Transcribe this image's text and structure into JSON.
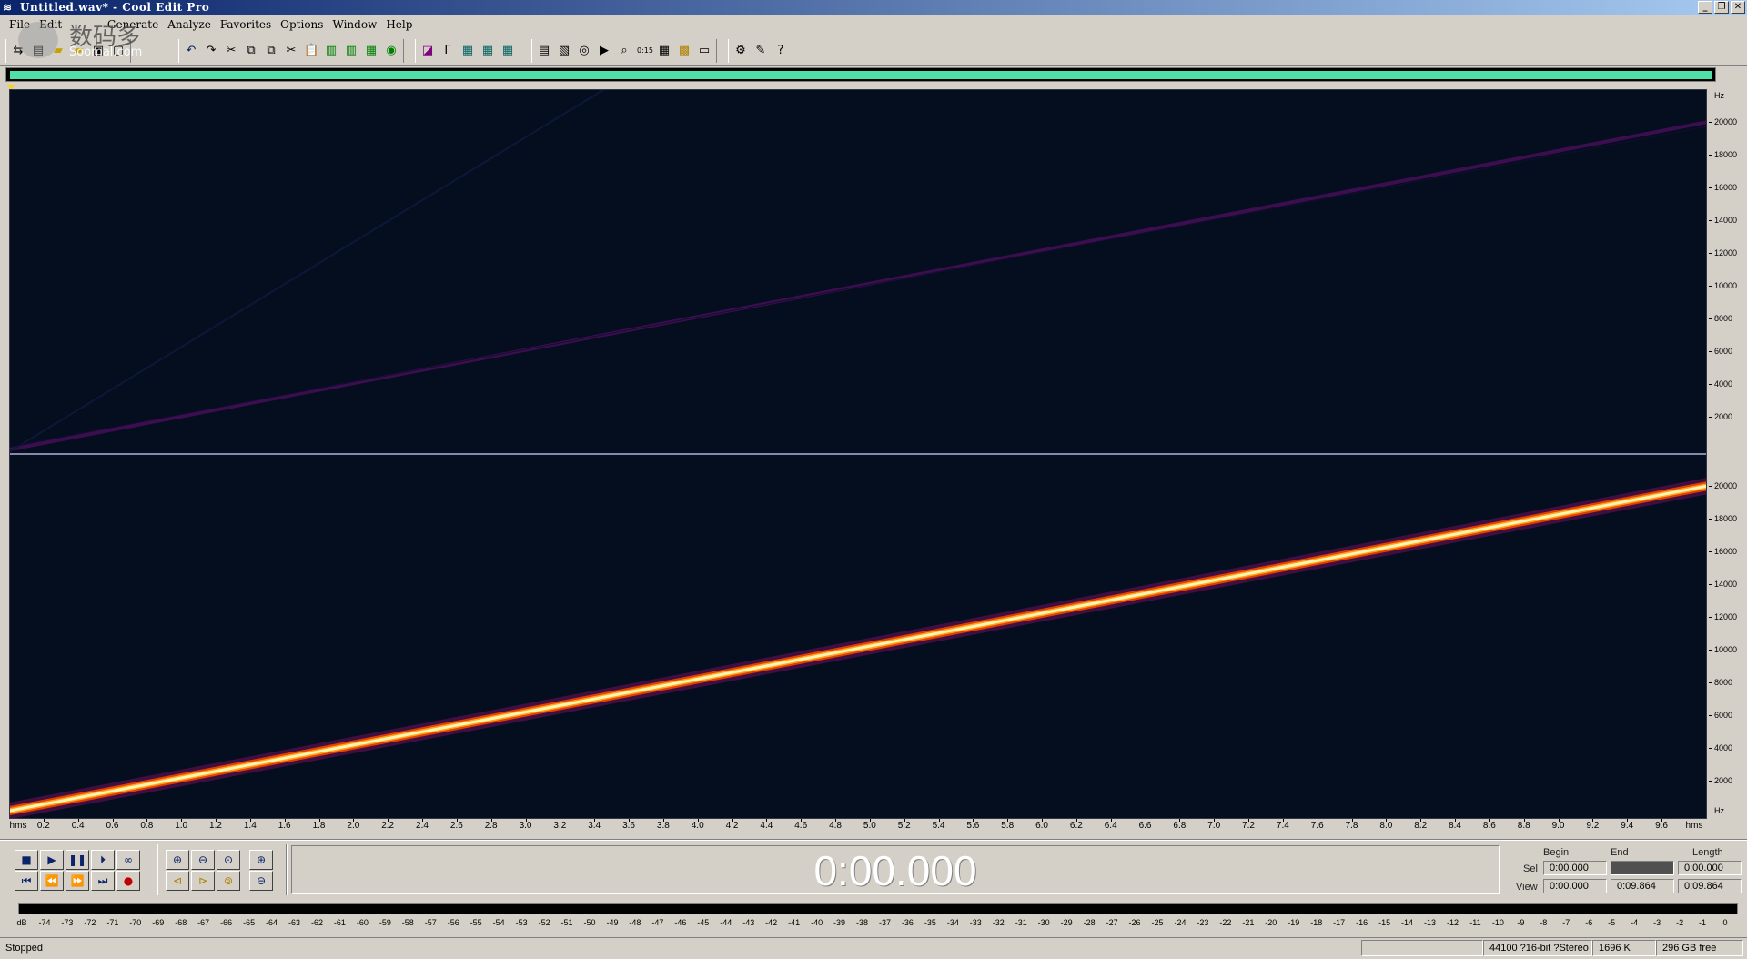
{
  "window": {
    "title": "Untitled.wav* - Cool Edit Pro",
    "app_icon": "waveform-icon",
    "buttons": [
      "_",
      "❐",
      "✕"
    ]
  },
  "menu": [
    "File",
    "Edit",
    "View",
    "Generate",
    "Analyze",
    "Favorites",
    "Options",
    "Window",
    "Help"
  ],
  "watermark": {
    "cn": "数码多",
    "en": "Soomal.com"
  },
  "spectrogram": {
    "channels": 2,
    "upper_channel_sweep_color": "#4a1060",
    "lower_channel_sweep_color": "#fff2a0",
    "background": "#050e1e"
  },
  "hz_ruler": {
    "unit": "Hz",
    "labels": [
      "20000",
      "18000",
      "16000",
      "14000",
      "12000",
      "10000",
      "8000",
      "6000",
      "4000",
      "2000"
    ]
  },
  "time_ruler": {
    "start_label": "hms",
    "end_label": "hms",
    "labels": [
      "0.2",
      "0.4",
      "0.6",
      "0.8",
      "1.0",
      "1.2",
      "1.4",
      "1.6",
      "1.8",
      "2.0",
      "2.2",
      "2.4",
      "2.6",
      "2.8",
      "3.0",
      "3.2",
      "3.4",
      "3.6",
      "3.8",
      "4.0",
      "4.2",
      "4.4",
      "4.6",
      "4.8",
      "5.0",
      "5.2",
      "5.4",
      "5.6",
      "5.8",
      "6.0",
      "6.2",
      "6.4",
      "6.6",
      "6.8",
      "7.0",
      "7.2",
      "7.4",
      "7.6",
      "7.8",
      "8.0",
      "8.2",
      "8.4",
      "8.6",
      "8.8",
      "9.0",
      "9.2",
      "9.4",
      "9.6"
    ]
  },
  "transport": {
    "row1": [
      "stop-icon",
      "play-icon",
      "pause-icon",
      "play-to-end-icon",
      "loop-icon"
    ],
    "row2": [
      "go-to-start-icon",
      "rewind-icon",
      "fast-forward-icon",
      "go-to-end-icon",
      "record-icon"
    ]
  },
  "zoom_tools": {
    "row1": [
      "zoom-in-horizontal-icon",
      "zoom-out-horizontal-icon",
      "zoom-full-icon",
      "zoom-in-vertical-icon"
    ],
    "row2": [
      "zoom-left-icon",
      "zoom-right-icon",
      "zoom-selection-icon",
      "zoom-out-vertical-icon"
    ]
  },
  "time_display": "0:00.000",
  "selection_view": {
    "headers": {
      "begin": "Begin",
      "end": "End",
      "length": "Length"
    },
    "sel": {
      "label": "Sel",
      "begin": "0:00.000",
      "end": "",
      "length": "0:00.000"
    },
    "view": {
      "label": "View",
      "begin": "0:00.000",
      "end": "0:09.864",
      "length": "0:09.864"
    }
  },
  "level_meter": {
    "labels": [
      "dB",
      "-74",
      "-73",
      "-72",
      "-71",
      "-70",
      "-69",
      "-68",
      "-67",
      "-66",
      "-65",
      "-64",
      "-63",
      "-62",
      "-61",
      "-60",
      "-59",
      "-58",
      "-57",
      "-56",
      "-55",
      "-54",
      "-53",
      "-52",
      "-51",
      "-50",
      "-49",
      "-48",
      "-47",
      "-46",
      "-45",
      "-44",
      "-43",
      "-42",
      "-41",
      "-40",
      "-39",
      "-38",
      "-37",
      "-36",
      "-35",
      "-34",
      "-33",
      "-32",
      "-31",
      "-30",
      "-29",
      "-28",
      "-27",
      "-26",
      "-25",
      "-24",
      "-23",
      "-22",
      "-21",
      "-20",
      "-19",
      "-18",
      "-17",
      "-16",
      "-15",
      "-14",
      "-13",
      "-12",
      "-11",
      "-10",
      "-9",
      "-8",
      "-7",
      "-6",
      "-5",
      "-4",
      "-3",
      "-2",
      "-1",
      "0"
    ]
  },
  "status": {
    "state": "Stopped",
    "format": "44100 ?16-bit ?Stereo",
    "size": "1696 K",
    "free": "296 GB free"
  }
}
